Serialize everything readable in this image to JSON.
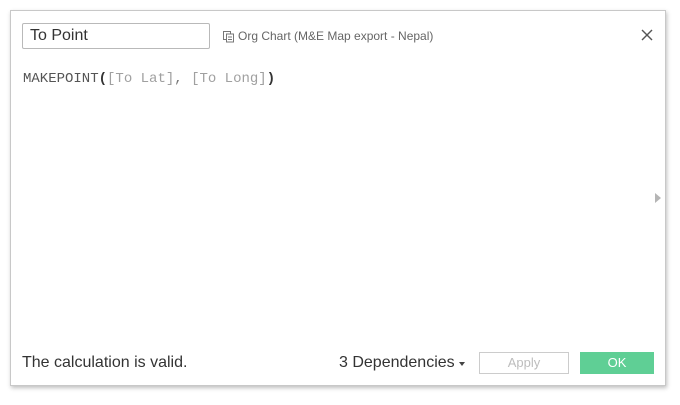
{
  "dialog": {
    "name_value": "To Point",
    "datasource_label": "Org Chart (M&E Map export - Nepal)",
    "datasource_icon": "datasource-icon",
    "close_icon": "close-icon"
  },
  "formula": {
    "function": "MAKEPOINT",
    "open": "(",
    "arg1": "[To Lat]",
    "sep": ", ",
    "arg2": "[To Long]",
    "close": ")"
  },
  "footer": {
    "status": "The calculation is valid.",
    "dependencies": "3 Dependencies",
    "apply_label": "Apply",
    "ok_label": "OK"
  },
  "colors": {
    "ok_button": "#5fcf95",
    "field_reference": "#a0a0a0",
    "border": "#c8c8c8"
  }
}
